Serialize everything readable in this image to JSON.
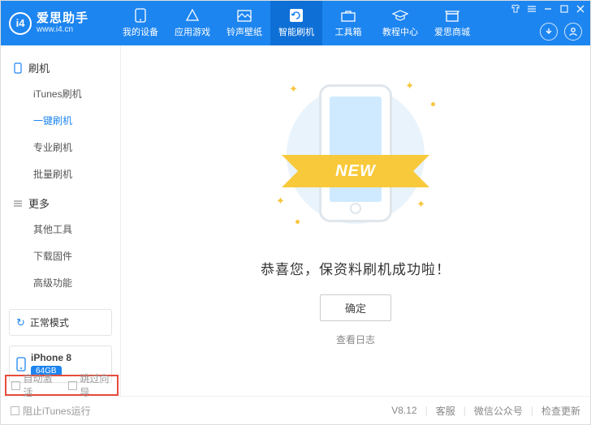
{
  "app": {
    "name": "爱思助手",
    "url": "www.i4.cn",
    "logo_letter": "i4"
  },
  "top_tabs": [
    {
      "label": "我的设备"
    },
    {
      "label": "应用游戏"
    },
    {
      "label": "铃声壁纸"
    },
    {
      "label": "智能刷机"
    },
    {
      "label": "工具箱"
    },
    {
      "label": "教程中心"
    },
    {
      "label": "爱思商城"
    }
  ],
  "sidebar": {
    "group1": {
      "title": "刷机",
      "items": [
        "iTunes刷机",
        "一键刷机",
        "专业刷机",
        "批量刷机"
      ]
    },
    "group2": {
      "title": "更多",
      "items": [
        "其他工具",
        "下载固件",
        "高级功能"
      ]
    }
  },
  "mode": {
    "label": "正常模式"
  },
  "device": {
    "name": "iPhone 8",
    "storage": "64GB"
  },
  "main": {
    "ribbon": "NEW",
    "success": "恭喜您，保资料刷机成功啦！",
    "ok": "确定",
    "log": "查看日志"
  },
  "options": {
    "auto_activate": "自动激活",
    "skip_wizard": "跳过向导"
  },
  "footer": {
    "block_itunes": "阻止iTunes运行",
    "version": "V8.12",
    "support": "客服",
    "wechat": "微信公众号",
    "update": "检查更新"
  }
}
